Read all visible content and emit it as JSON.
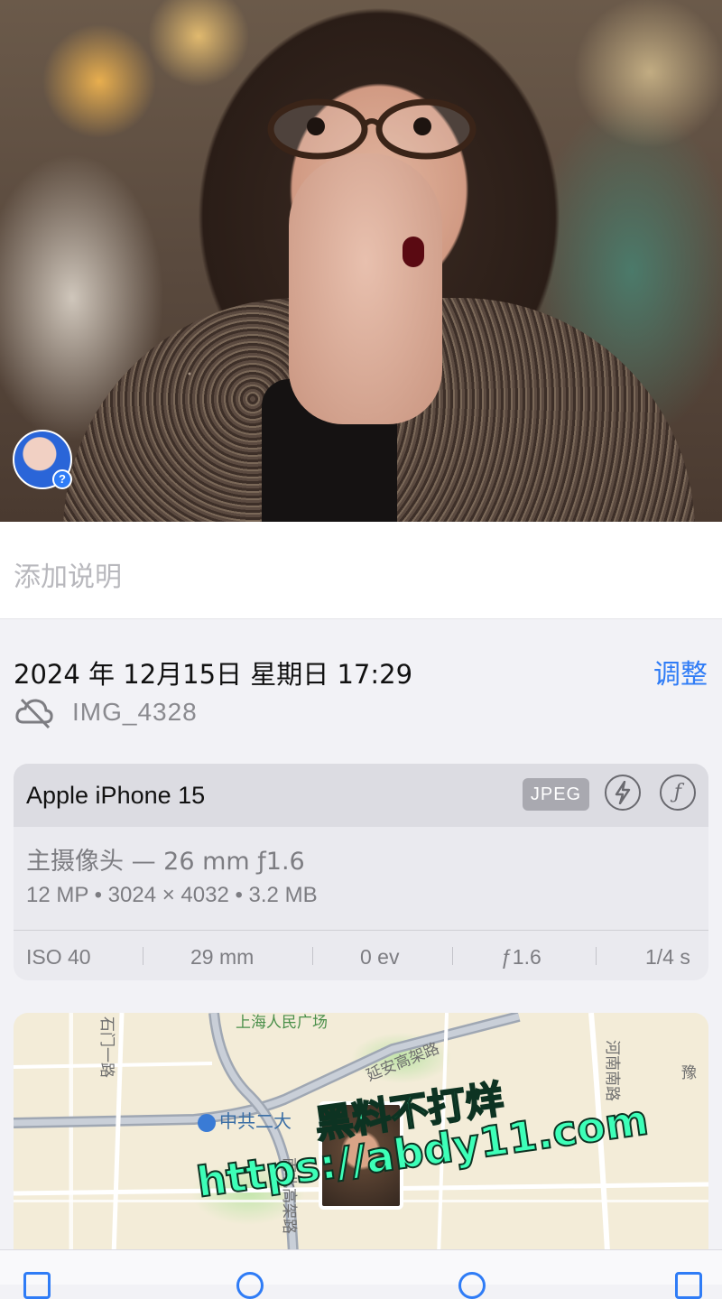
{
  "photo": {
    "description_icon": "portrait-photo",
    "avatar_badge": "?"
  },
  "caption": {
    "placeholder": "添加说明"
  },
  "info": {
    "datetime": "2024 年 12月15日 星期日 17:29",
    "adjust_label": "调整",
    "cloud_icon": "cloud-off-icon",
    "filename": "IMG_4328"
  },
  "exif": {
    "device": "Apple iPhone 15",
    "format_badge": "JPEG",
    "flash_icon": "flash-off-icon",
    "aperture_icon": "aperture-f-icon",
    "aperture_glyph": "ƒ",
    "lens": "主摄像头 — 26 mm ƒ1.6",
    "specs": "12 MP  •  3024 × 4032  •  3.2 MB",
    "row": [
      "ISO 40",
      "29 mm",
      "0 ev",
      "ƒ1.6",
      "1/4 s"
    ]
  },
  "map": {
    "labels": {
      "top_square": "上海人民广场",
      "left_road": "石门一路",
      "yanan": "延安高架路",
      "henan": "河南南路",
      "poi": "中共二大",
      "right": "豫",
      "bottom": "南北高架路"
    }
  },
  "watermark": {
    "line1": "黑料不打烊",
    "line2": "https://abdy11.com"
  },
  "colors": {
    "accent": "#2f7cf6",
    "watermark": "#3dffb8"
  }
}
